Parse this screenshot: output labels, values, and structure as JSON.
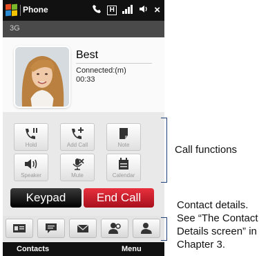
{
  "header": {
    "app_title": "Phone",
    "close_glyph": "×",
    "network": "3G",
    "status_icons": [
      "phone-call-icon",
      "h-data-icon",
      "signal-icon",
      "volume-icon"
    ]
  },
  "contact": {
    "name": "Best",
    "status": "Connected:(m)",
    "duration": "00:33"
  },
  "functions": [
    {
      "label": "Hold",
      "icon": "hold-icon"
    },
    {
      "label": "Add Call",
      "icon": "add-call-icon"
    },
    {
      "label": "Note",
      "icon": "note-icon"
    },
    {
      "label": "Speaker",
      "icon": "speaker-icon"
    },
    {
      "label": "Mute",
      "icon": "mute-icon"
    },
    {
      "label": "Calendar",
      "icon": "calendar-icon"
    }
  ],
  "actions": {
    "keypad": "Keypad",
    "end_call": "End Call"
  },
  "contact_details_icons": [
    "contact-card-icon",
    "message-icon",
    "email-icon",
    "contact-search-icon",
    "contact-person-icon"
  ],
  "softkeys": {
    "left": "Contacts",
    "right": "Menu"
  },
  "annotations": {
    "functions": "Call functions",
    "details_line1": "Contact details.",
    "details_line2": "See “The Contact",
    "details_line3": "Details screen” in",
    "details_line4": "Chapter 3."
  },
  "colors": {
    "end_call": "#c8141f",
    "keypad": "#1a1a1a",
    "bracket": "#1f3f7a"
  }
}
